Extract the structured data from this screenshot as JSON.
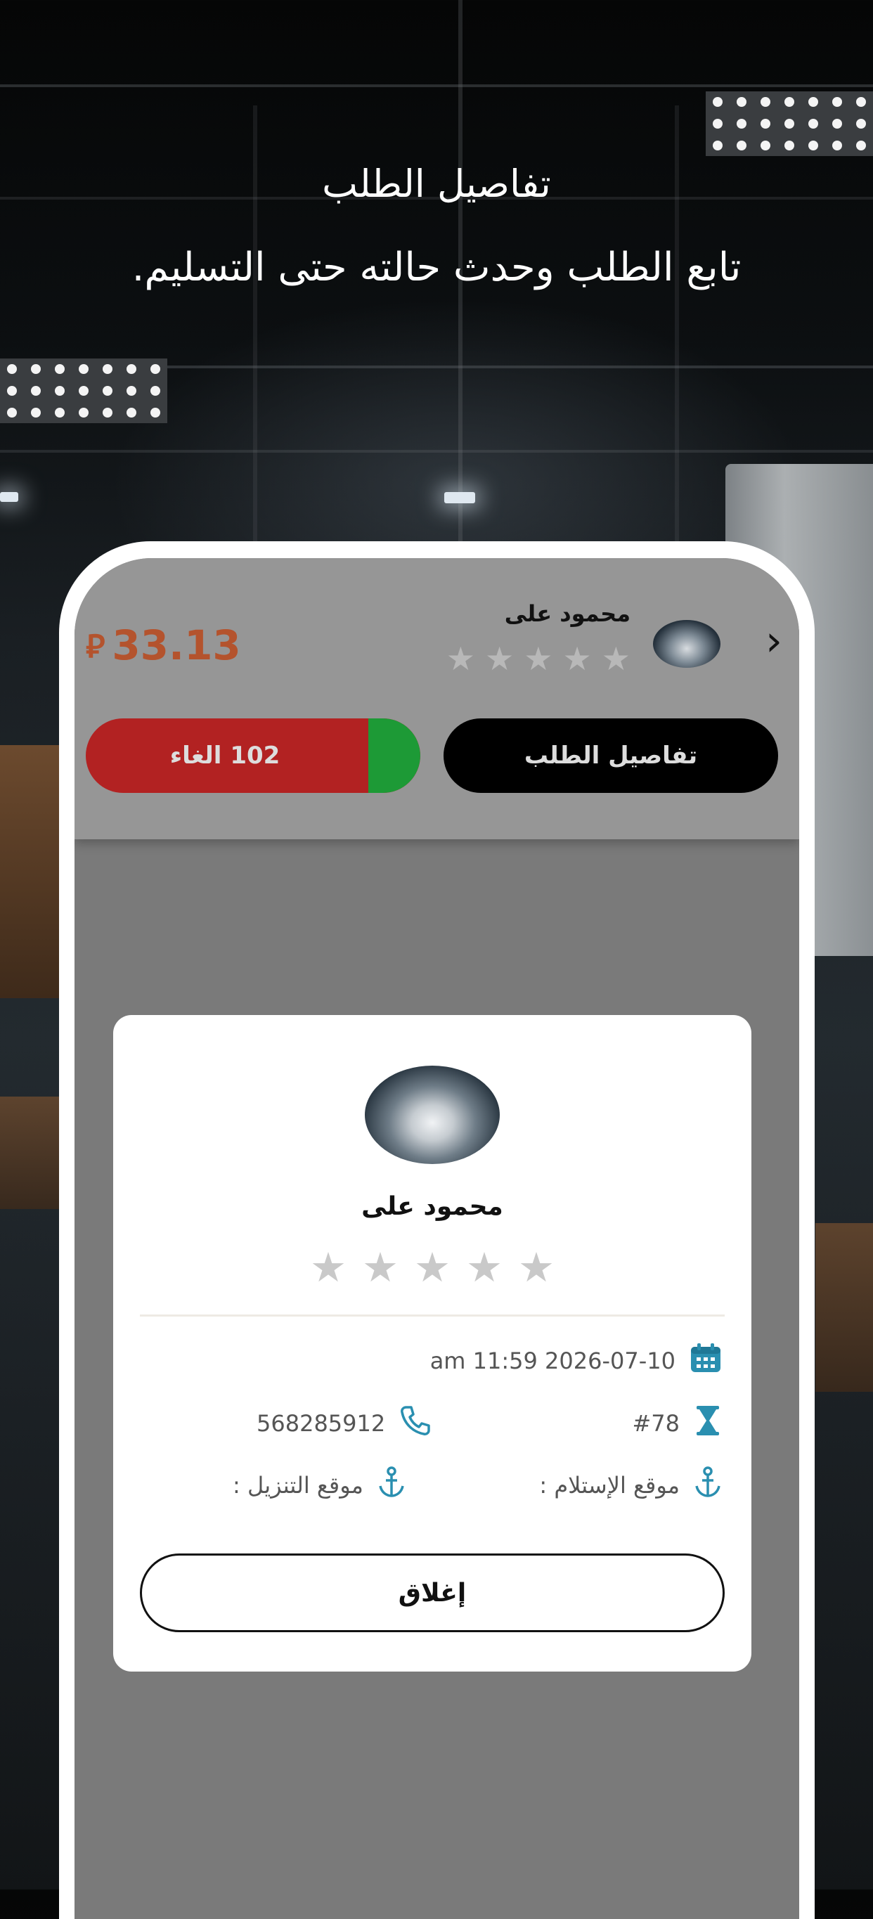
{
  "header": {
    "title": "تفاصيل الطلب",
    "subtitle": "تابع الطلب وحدث حالته حتى التسليم."
  },
  "order_card": {
    "price": "33.13",
    "currency_symbol": "⃁",
    "user_name": "محمود على",
    "rating_stars": 5,
    "details_button": "تفاصيل الطلب",
    "cancel_button": "102  الغاء",
    "back_icon": "chevron-right-icon"
  },
  "modal": {
    "user_name": "محمود على",
    "rating_stars": 5,
    "datetime": "am 11:59 2026-07-10",
    "order_number": "#78",
    "phone": "568285912",
    "pickup_label": "موقع الإستلام :",
    "dropoff_label": "موقع التنزيل :",
    "close_button": "إغلاق",
    "icons": {
      "date": "calendar-icon",
      "order": "hourglass-icon",
      "phone": "phone-icon",
      "pickup": "anchor-icon",
      "dropoff": "anchor-icon"
    }
  },
  "colors": {
    "price": "#b4532d",
    "cancel": "#b22222",
    "toggle": "#1d9a36",
    "icon_accent": "#2a8fb0"
  }
}
